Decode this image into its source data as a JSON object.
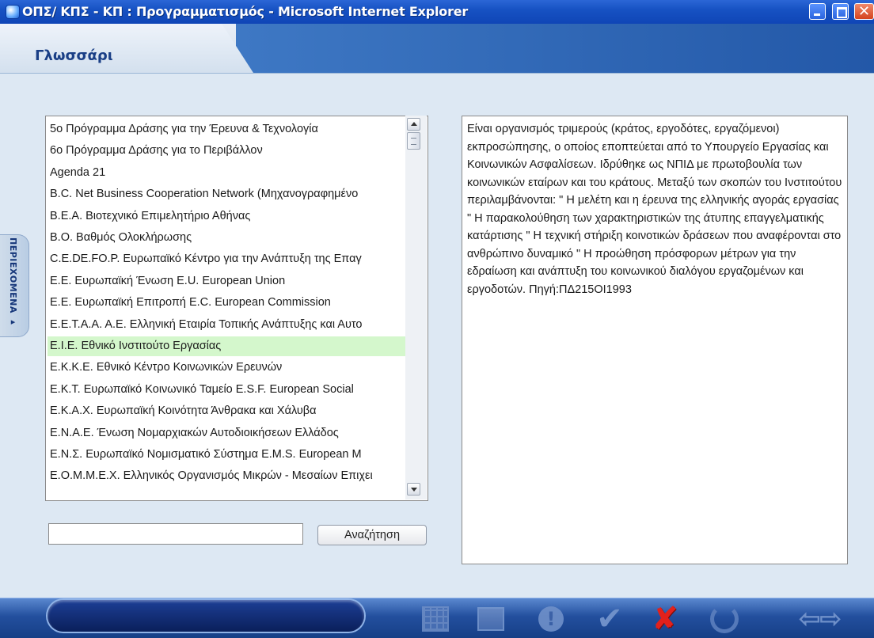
{
  "window": {
    "title": "ΟΠΣ/ ΚΠΣ - ΚΠ : Προγραμματισμός - Microsoft Internet Explorer",
    "close_glyph": "✕"
  },
  "header": {
    "tab_label": "Γλωσσάρι"
  },
  "sidebar": {
    "label": "ΠΕΡΙΕΧΟΜΕΝΑ ▸"
  },
  "glossary": {
    "items": [
      "5ο Πρόγραμμα Δράσης για την Έρευνα & Τεχνολογία",
      "6ο Πρόγραμμα Δράσης για το Περιβάλλον",
      "Agenda 21",
      "B.C. Net Business Cooperation Network (Μηχανογραφημένο",
      "Β.Ε.Α. Βιοτεχνικό Επιμελητήριο Αθήνας",
      "Β.Ο. Βαθμός Ολοκλήρωσης",
      "C.E.DE.FO.P. Ευρωπαϊκό Κέντρο για την Ανάπτυξη της Επαγ",
      "Ε.Ε. Ευρωπαϊκή Ένωση E.U. European Union",
      "Ε.Ε. Ευρωπαϊκή Επιτροπή E.C. European Commission",
      "Ε.Ε.Τ.Α.Α. Α.Ε. Ελληνική Εταιρία Τοπικής Ανάπτυξης και Αυτο",
      "Ε.Ι.Ε. Εθνικό Ινστιτούτο Εργασίας",
      "Ε.Κ.Κ.Ε. Εθνικό Κέντρο Κοινωνικών Ερευνών",
      "Ε.Κ.Τ. Ευρωπαϊκό Κοινωνικό Ταμείο E.S.F. European Social",
      "Ε.Κ.Α.Χ. Ευρωπαϊκή Κοινότητα Άνθρακα και Χάλυβα",
      "Ε.Ν.Α.Ε. Ένωση Νομαρχιακών Αυτοδιοικήσεων Ελλάδος",
      "Ε.Ν.Σ. Ευρωπαϊκό Νομισματικό Σύστημα E.M.S. European M",
      "Ε.Ο.Μ.Μ.Ε.Χ. Ελληνικός Οργανισμός Μικρών - Μεσαίων Επιχει"
    ],
    "selected_index": 10
  },
  "search": {
    "value": "",
    "button_label": "Αναζήτηση"
  },
  "detail": {
    "text": "Είναι οργανισμός τριμερούς (κράτος, εργοδότες, εργαζόμενοι) εκπροσώπησης, ο οποίος εποπτεύεται από το Υπουργείο Εργασίας και Κοινωνικών Ασφαλίσεων. Ιδρύθηκε ως ΝΠΙΔ με πρωτοβουλία των κοινωνικών εταίρων και του κράτους. Μεταξύ των σκοπών του Ινστιτούτου περιλαμβάνονται: \" Η μελέτη και η έρευνα της ελληνικής αγοράς εργασίας \" Η παρακολούθηση των χαρακτηριστικών της άτυπης επαγγελματικής κατάρτισης \" Η τεχνική στήριξη κοινοτικών δράσεων που αναφέρονται στο ανθρώπινο δυναμικό \" Η προώθηση πρόσφορων μέτρων για την εδραίωση και ανάπτυξη του κοινωνικού διαλόγου εργαζομένων και εργοδοτών. Πηγή:ΠΔ215ΟΙ1993"
  },
  "toolbar": {
    "icons": [
      "grid-icon",
      "edit-icon",
      "warning-icon",
      "check-icon",
      "cross-icon",
      "refresh-icon",
      "arrows-icon"
    ],
    "check_glyph": "✔",
    "cross_glyph": "✘",
    "warn_glyph": "!",
    "arrows_glyph": "⇦⇨"
  }
}
